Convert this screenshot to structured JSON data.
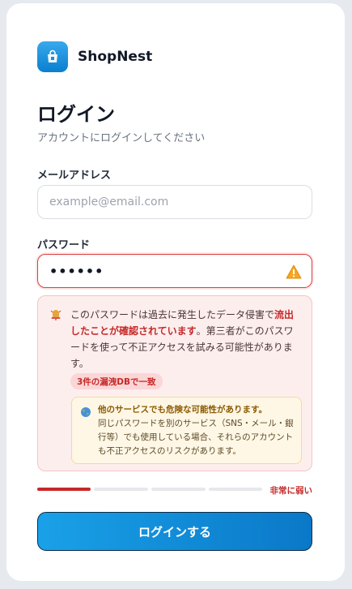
{
  "brand": {
    "name": "ShopNest",
    "logo_icon": "shopping-bag-icon"
  },
  "heading": {
    "title": "ログイン",
    "subtitle": "アカウントにログインしてください"
  },
  "email": {
    "label": "メールアドレス",
    "placeholder": "example@email.com",
    "value": ""
  },
  "password": {
    "label": "パスワード",
    "value": "••••••",
    "status_icon": "warning-icon"
  },
  "breach_alert": {
    "icon": "alert-bell-icon",
    "text_before": "このパスワードは過去に発生したデータ侵害で",
    "text_strong": "流出したことが確認されています",
    "text_after": "。第三者がこのパスワードを使って不正アクセスを試みる可能性があります。",
    "tag": "3件の漏洩DBで一致",
    "reuse_warning": {
      "icon": "globe-icon",
      "title": "他のサービスでも危険な可能性があります。",
      "text": "同じパスワードを別のサービス（SNS・メール・銀行等）でも使用している場合、それらのアカウントも不正アクセスのリスクがあります。"
    }
  },
  "strength": {
    "level": 1,
    "max": 4,
    "label": "非常に弱い"
  },
  "submit": {
    "label": "ログインする"
  },
  "colors": {
    "accent": "#0b86d6",
    "danger": "#c62828",
    "warning": "#f5a623"
  }
}
